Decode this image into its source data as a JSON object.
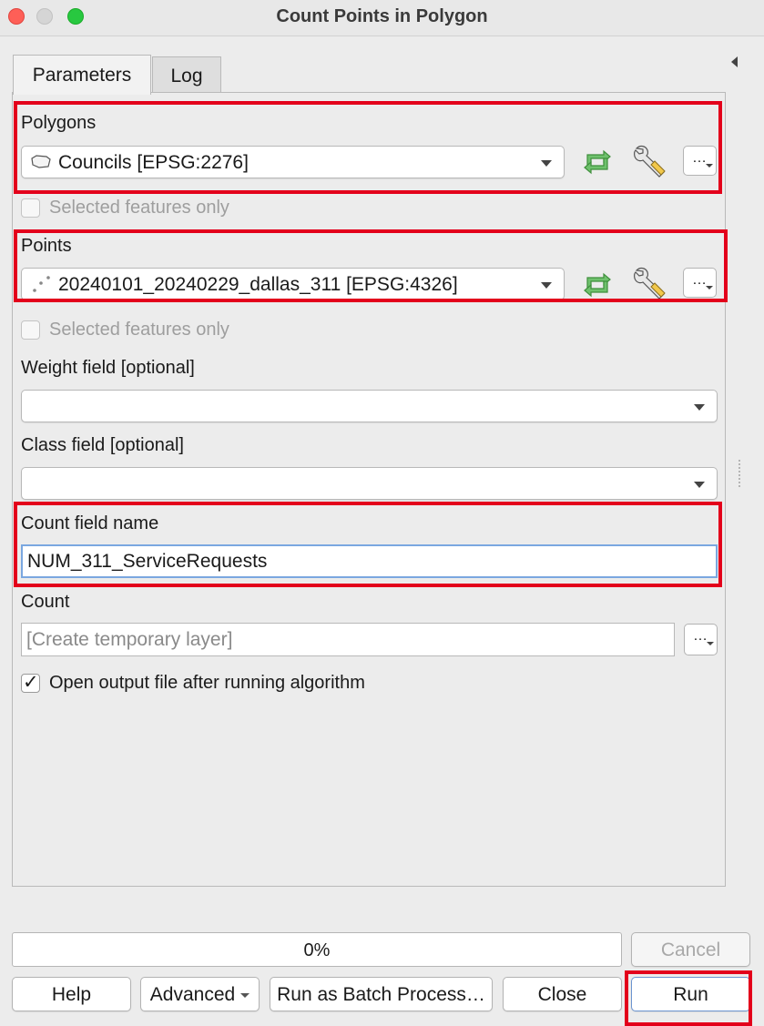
{
  "window": {
    "title": "Count Points in Polygon"
  },
  "tabs": [
    {
      "label": "Parameters"
    },
    {
      "label": "Log"
    }
  ],
  "params": {
    "polygons": {
      "label": "Polygons",
      "value": "Councils [EPSG:2276]"
    },
    "polygons_selected_only": {
      "label": "Selected features only",
      "checked": false
    },
    "points": {
      "label": "Points",
      "value": "20240101_20240229_dallas_311 [EPSG:4326]"
    },
    "points_selected_only": {
      "label": "Selected features only",
      "checked": false
    },
    "weight_field": {
      "label": "Weight field [optional]",
      "value": ""
    },
    "class_field": {
      "label": "Class field [optional]",
      "value": ""
    },
    "count_field_name": {
      "label": "Count field name",
      "value": "NUM_311_ServiceRequests"
    },
    "count": {
      "label": "Count",
      "placeholder": "[Create temporary layer]"
    },
    "open_output": {
      "label": "Open output file after running algorithm",
      "checked": true
    }
  },
  "ellipsis": "…",
  "checkmark": "✓",
  "progress": {
    "text": "0%",
    "value": 0
  },
  "buttons": {
    "cancel": "Cancel",
    "help": "Help",
    "advanced": "Advanced",
    "batch": "Run as Batch Process…",
    "close": "Close",
    "run": "Run"
  },
  "icons": {
    "polygon_layer": "polygon-layer-icon",
    "point_layer": "point-layer-icon",
    "iterate": "iterate-icon",
    "settings": "wrench-icon"
  },
  "colors": {
    "highlight": "#e3001b",
    "iterate_green": "#4caf50",
    "focus_blue": "#7aa7e0"
  }
}
